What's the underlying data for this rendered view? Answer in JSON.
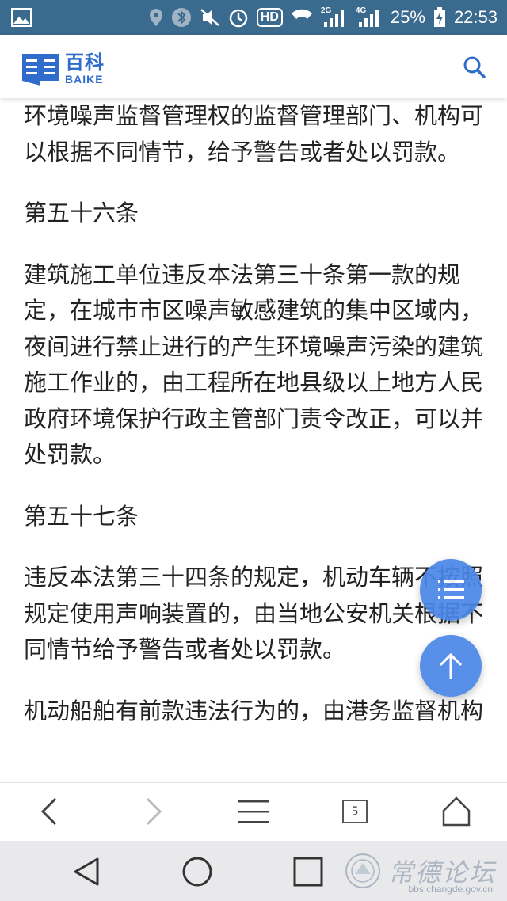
{
  "status_bar": {
    "battery": "25%",
    "time": "22:53",
    "net_2g": "2G",
    "net_4g": "4G",
    "hd": "HD",
    "icons": [
      "image-icon",
      "location-icon",
      "bluetooth-icon",
      "mute-icon",
      "alarm-icon",
      "hd-icon",
      "wifi-icon",
      "signal-2g-icon",
      "signal-4g-icon",
      "battery-charging-icon"
    ]
  },
  "header": {
    "logo_cn": "百科",
    "logo_en": "BAIKE",
    "search_icon": "search-icon"
  },
  "article": {
    "paragraphs": [
      "环境噪声监督管理权的监督管理部门、机构可以根据不同情节，给予警告或者处以罚款。",
      "第五十六条",
      "建筑施工单位违反本法第三十条第一款的规定，在城市市区噪声敏感建筑的集中区域内，夜间进行禁止进行的产生环境噪声污染的建筑施工作业的，由工程所在地县级以上地方人民政府环境保护行政主管部门责令改正，可以并处罚款。",
      "第五十七条",
      "违反本法第三十四条的规定，机动车辆不按照规定使用声响装置的，由当地公安机关根据不同情节给予警告或者处以罚款。",
      "机动船舶有前款违法行为的，由港务监督机构"
    ]
  },
  "fabs": {
    "menu_icon": "list-icon",
    "top_icon": "arrow-up-icon"
  },
  "browser_bar": {
    "tab_count": "5",
    "icons": [
      "back-icon",
      "forward-icon",
      "menu-icon",
      "tabs-icon",
      "home-icon"
    ]
  },
  "system_nav": {
    "icons": [
      "nav-back-icon",
      "nav-home-icon",
      "nav-recents-icon"
    ]
  },
  "watermark": {
    "text": "常德论坛",
    "url": "bbs.changde.gov.cn"
  },
  "colors": {
    "status_bar": "#3a6a8e",
    "brand_blue": "#2f6ccc",
    "fab_blue": "#4a86e8",
    "nav_bg": "#e9e9eb"
  }
}
